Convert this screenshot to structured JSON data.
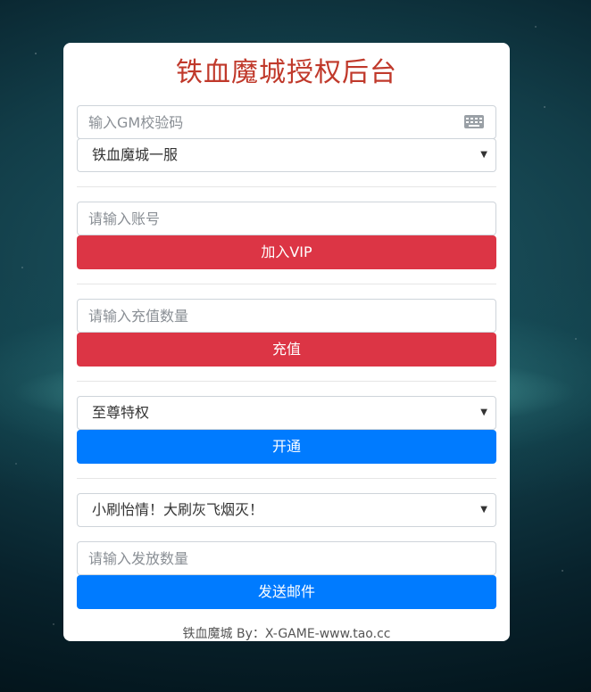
{
  "header": {
    "title": "铁血魔城授权后台"
  },
  "gm_code": {
    "placeholder": "输入GM校验码",
    "icon": "keyboard-icon"
  },
  "server_select": {
    "selected": "铁血魔城一服"
  },
  "vip": {
    "account_placeholder": "请输入账号",
    "button_label": "加入VIP"
  },
  "recharge": {
    "amount_placeholder": "请输入充值数量",
    "button_label": "充值"
  },
  "privilege": {
    "selected": "至尊特权",
    "button_label": "开通"
  },
  "mail": {
    "item_selected": "小刷怡情！大刷灰飞烟灭！",
    "quantity_placeholder": "请输入发放数量",
    "button_label": "发送邮件"
  },
  "footer": {
    "text": "铁血魔城 By：X-GAME-www.tao.cc"
  },
  "colors": {
    "title": "#c0392b",
    "danger": "#dc3545",
    "primary": "#007bff"
  }
}
